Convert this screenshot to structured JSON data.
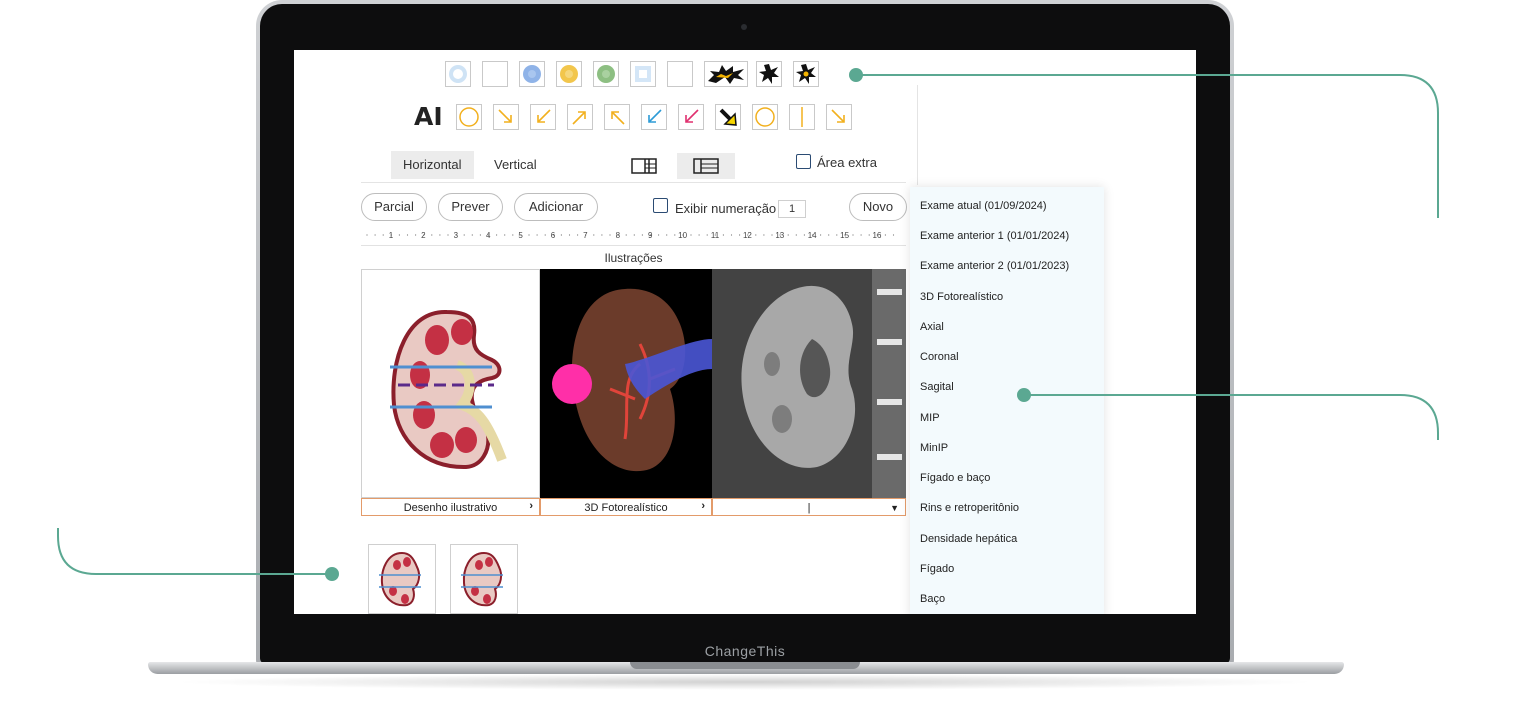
{
  "toolbar": {
    "row1_icons": [
      "circle-tool-icon",
      "square-tool-icon",
      "blue-flower-icon",
      "yellow-flower-icon",
      "green-flower-icon",
      "square-inset-icon",
      "blank-square-icon",
      "burst-yellow-icon",
      "burst-small-icon",
      "burst-star-icon"
    ],
    "row2_icons": [
      "text-tool-icon",
      "circle-outline-icon",
      "arrow-down-right-icon",
      "arrow-down-left-icon",
      "arrow-up-right-icon",
      "arrow-up-left-icon",
      "arrow-blue-icon",
      "arrow-pink-icon",
      "arrow-bold-icon",
      "circle-outline-2-icon",
      "vertical-line-icon",
      "arrow-down-right-2-icon"
    ],
    "text_tool_label": "AI"
  },
  "layout_tabs": {
    "horizontal": "Horizontal",
    "vertical": "Vertical"
  },
  "extra_area_label": "Área extra",
  "buttons": {
    "parcial": "Parcial",
    "prever": "Prever",
    "adicionar": "Adicionar",
    "novo": "Novo"
  },
  "numbering": {
    "label": "Exibir numeração",
    "value": "1"
  },
  "ruler_ticks": [
    "1",
    "2",
    "3",
    "4",
    "5",
    "6",
    "7",
    "8",
    "9",
    "10",
    "11",
    "12",
    "13",
    "14",
    "15",
    "16"
  ],
  "illustrations": {
    "title": "Ilustrações",
    "captions": [
      "Desenho ilustrativo",
      "3D Fotorealístico",
      "|"
    ]
  },
  "dropdown": {
    "items": [
      "Exame atual (01/09/2024)",
      "Exame anterior 1 (01/01/2024)",
      "Exame anterior 2 (01/01/2023)",
      "3D Fotorealístico",
      "Axial",
      "Coronal",
      "Sagital",
      "MIP",
      "MinIP",
      "Fígado e baço",
      "Rins e retroperitônio",
      "Densidade hepática",
      "Fígado",
      "Baço"
    ]
  },
  "laptop_label": "ChangeThis",
  "colors": {
    "accent": "#5ba892",
    "caption_border": "#e39b6a"
  }
}
